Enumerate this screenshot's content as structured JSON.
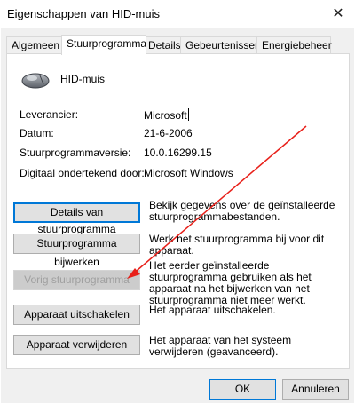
{
  "window": {
    "title": "Eigenschappen van HID-muis",
    "close_glyph": "✕"
  },
  "tabs": [
    {
      "label": "Algemeen"
    },
    {
      "label": "Stuurprogramma",
      "active": true
    },
    {
      "label": "Details"
    },
    {
      "label": "Gebeurtenissen"
    },
    {
      "label": "Energiebeheer"
    }
  ],
  "device": {
    "name": "HID-muis",
    "icon": "mouse-icon"
  },
  "info": [
    {
      "label": "Leverancier:",
      "value": "Microsoft"
    },
    {
      "label": "Datum:",
      "value": "21-6-2006"
    },
    {
      "label": "Stuurprogrammaversie:",
      "value": "10.0.16299.15"
    },
    {
      "label": "Digitaal ondertekend door:",
      "value": "Microsoft Windows"
    }
  ],
  "actions": [
    {
      "button": "Details van stuurprogramma",
      "description": "Bekijk gegevens over de geïnstalleerde stuurprogrammabestanden."
    },
    {
      "button": "Stuurprogramma bijwerken",
      "description": "Werk het stuurprogramma bij voor dit apparaat."
    },
    {
      "button": "Vorig stuurprogramma",
      "description": "Het eerder geïnstalleerde stuurprogramma gebruiken als het apparaat na het bijwerken van het stuurprogramma niet meer werkt.",
      "disabled": true
    },
    {
      "button": "Apparaat uitschakelen",
      "description": "Het apparaat uitschakelen."
    },
    {
      "button": "Apparaat verwijderen",
      "description": "Het apparaat van het systeem verwijderen (geavanceerd)."
    }
  ],
  "footer": {
    "ok": "OK",
    "cancel": "Annuleren"
  },
  "colors": {
    "focus": "#0078d7",
    "annotation_arrow": "#e8201a"
  }
}
